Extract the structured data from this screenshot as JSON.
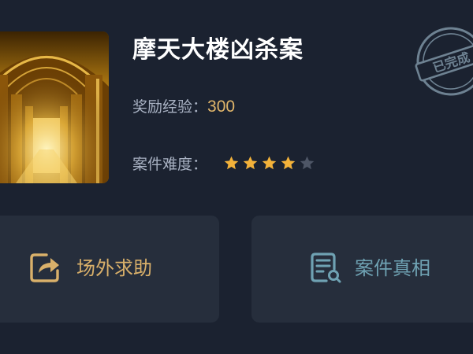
{
  "case": {
    "title": "摩天大楼凶杀案",
    "reward_label": "奖励经验：",
    "reward_value": "300",
    "difficulty_label": "案件难度：",
    "difficulty_stars": 4,
    "difficulty_max": 5,
    "stamp_text": "已完成"
  },
  "actions": {
    "help_label": "场外求助",
    "truth_label": "案件真相"
  },
  "icons": {
    "help": "share-arrow-icon",
    "truth": "document-search-icon",
    "star": "star-icon",
    "stamp": "completed-stamp-icon"
  },
  "colors": {
    "background": "#1b2230",
    "button_bg": "#262e3c",
    "title": "#ffffff",
    "label": "#a9b2c3",
    "gold": "#d9b06a",
    "teal": "#6fa2b3",
    "star_on": "#f3b23a",
    "star_off": "#4e5666"
  }
}
